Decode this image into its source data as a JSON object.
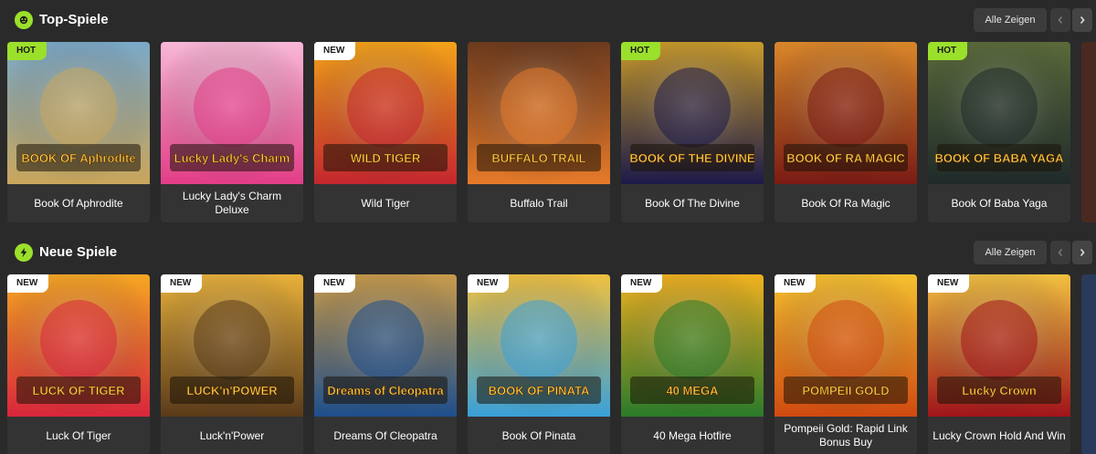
{
  "sections": [
    {
      "title": "Top-Spiele",
      "icon": "controller-icon",
      "show_all_label": "Alle Zeigen",
      "games": [
        {
          "name": "Book Of Aphrodite",
          "badge": "HOT",
          "art_text": "BOOK OF Aphrodite",
          "bg1": "#c9a65b",
          "bg2": "#7aa8c8"
        },
        {
          "name": "Lucky Lady's Charm Deluxe",
          "badge": "",
          "art_text": "Lucky Lady's Charm",
          "bg1": "#e23d86",
          "bg2": "#f7b8d6"
        },
        {
          "name": "Wild Tiger",
          "badge": "NEW",
          "art_text": "WILD TIGER",
          "bg1": "#c4262e",
          "bg2": "#f2a21a"
        },
        {
          "name": "Buffalo Trail",
          "badge": "",
          "art_text": "BUFFALO TRAIL",
          "bg1": "#e67a2a",
          "bg2": "#6b3a1e"
        },
        {
          "name": "Book Of The Divine",
          "badge": "HOT",
          "art_text": "BOOK OF THE DIVINE",
          "bg1": "#1c1a4a",
          "bg2": "#c99a2a"
        },
        {
          "name": "Book Of Ra Magic",
          "badge": "",
          "art_text": "BOOK OF RA MAGIC",
          "bg1": "#7a1a14",
          "bg2": "#d8862a"
        },
        {
          "name": "Book Of Baba Yaga",
          "badge": "HOT",
          "art_text": "BOOK OF BABA YAGA",
          "bg1": "#1f2a2a",
          "bg2": "#5a6a3a"
        }
      ]
    },
    {
      "title": "Neue Spiele",
      "icon": "lightning-icon",
      "show_all_label": "Alle Zeigen",
      "games": [
        {
          "name": "Luck Of Tiger",
          "badge": "NEW",
          "art_text": "LUCK OF TIGER",
          "bg1": "#d8263c",
          "bg2": "#f5a623"
        },
        {
          "name": "Luck'n'Power",
          "badge": "NEW",
          "art_text": "LUCK'n'POWER",
          "bg1": "#5a3a1a",
          "bg2": "#e8b03a"
        },
        {
          "name": "Dreams Of Cleopatra",
          "badge": "NEW",
          "art_text": "Dreams of Cleopatra",
          "bg1": "#1e4e8c",
          "bg2": "#c89a4a"
        },
        {
          "name": "Book Of Pinata",
          "badge": "NEW",
          "art_text": "BOOK OF PINATA",
          "bg1": "#3aa0d8",
          "bg2": "#f0c040"
        },
        {
          "name": "40 Mega Hotfire",
          "badge": "NEW",
          "art_text": "40 MEGA",
          "bg1": "#2a7a2a",
          "bg2": "#f0b020"
        },
        {
          "name": "Pompeii Gold: Rapid Link Bonus Buy",
          "badge": "NEW",
          "art_text": "POMPEII GOLD",
          "bg1": "#d04a10",
          "bg2": "#f5c030"
        },
        {
          "name": "Lucky Crown Hold And Win",
          "badge": "NEW",
          "art_text": "Lucky Crown",
          "bg1": "#a0141a",
          "bg2": "#f0c040"
        }
      ]
    }
  ],
  "colors": {
    "accent": "#9be02b",
    "background": "#2a2a2a",
    "card": "#333333",
    "badge_new": "#ffffff"
  }
}
